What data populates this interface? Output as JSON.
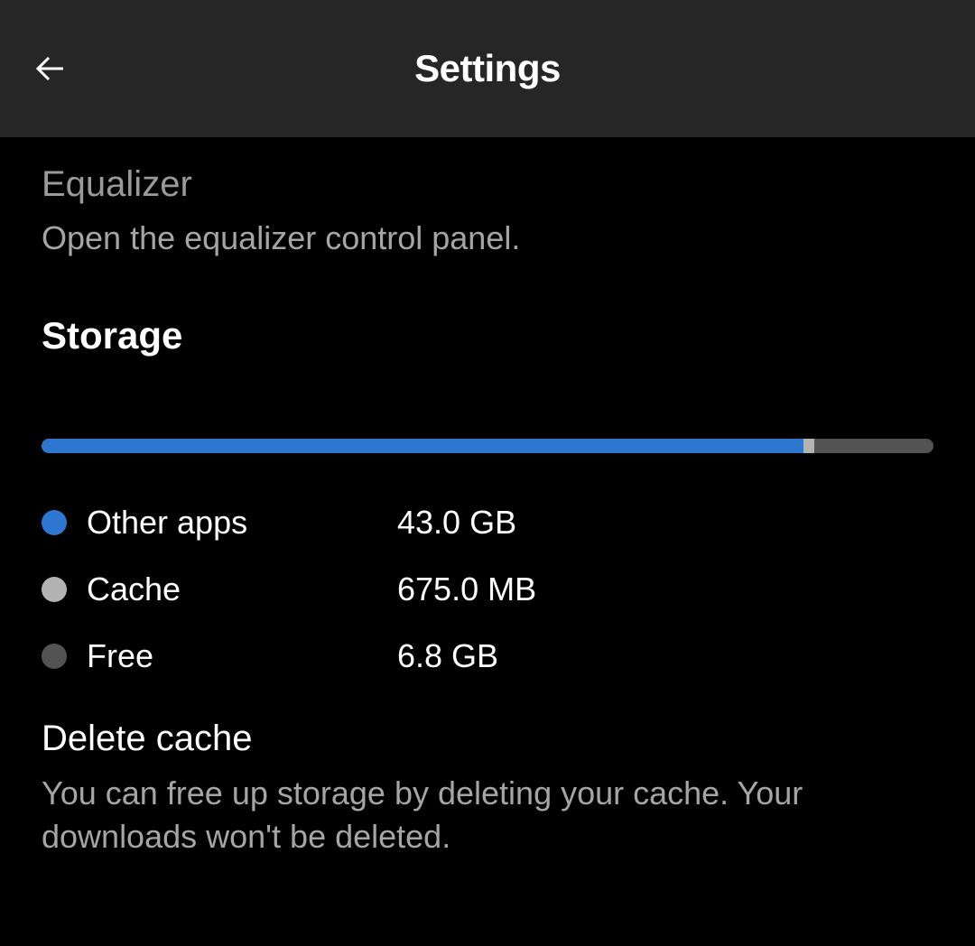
{
  "header": {
    "title": "Settings"
  },
  "equalizer": {
    "title": "Equalizer",
    "description": "Open the equalizer control panel."
  },
  "storage": {
    "heading": "Storage",
    "bar": {
      "other_percent": 85.4,
      "cache_percent": 1.2,
      "free_percent": 13.4
    },
    "legend": [
      {
        "label": "Other apps",
        "value": "43.0 GB",
        "color": "#2e77d0"
      },
      {
        "label": "Cache",
        "value": "675.0 MB",
        "color": "#b3b3b3"
      },
      {
        "label": "Free",
        "value": "6.8 GB",
        "color": "#535353"
      }
    ]
  },
  "delete_cache": {
    "title": "Delete cache",
    "description": "You can free up storage by deleting your cache. Your downloads won't be deleted."
  }
}
